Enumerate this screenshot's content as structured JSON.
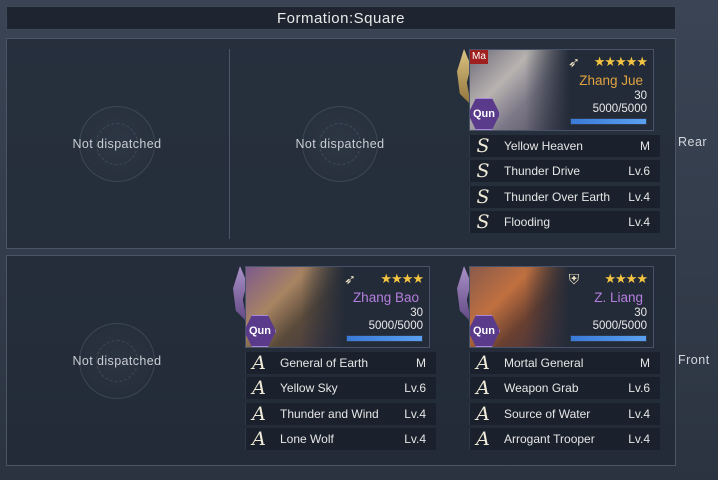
{
  "formation": {
    "title": "Formation:Square"
  },
  "rows": {
    "rear": {
      "label": "Rear"
    },
    "front": {
      "label": "Front"
    }
  },
  "empty_text": "Not dispatched",
  "generals": {
    "zhang_jue": {
      "tag": "Ma",
      "class_icon": "bow-icon",
      "stars": "★★★★★",
      "name": "Zhang Jue",
      "level": "30",
      "troops": "5000/5000",
      "troop_fill": 1.0,
      "faction": "Qun",
      "skills": [
        {
          "grade": "S",
          "name": "Yellow Heaven",
          "lv": "M"
        },
        {
          "grade": "S",
          "name": "Thunder Drive",
          "lv": "Lv.6"
        },
        {
          "grade": "S",
          "name": "Thunder Over Earth",
          "lv": "Lv.4"
        },
        {
          "grade": "S",
          "name": "Flooding",
          "lv": "Lv.4"
        }
      ]
    },
    "zhang_bao": {
      "class_icon": "bow-icon",
      "stars": "★★★★",
      "name": "Zhang Bao",
      "level": "30",
      "troops": "5000/5000",
      "troop_fill": 1.0,
      "faction": "Qun",
      "skills": [
        {
          "grade": "A",
          "name": "General of Earth",
          "lv": "M"
        },
        {
          "grade": "A",
          "name": "Yellow Sky",
          "lv": "Lv.6"
        },
        {
          "grade": "A",
          "name": "Thunder and Wind",
          "lv": "Lv.4"
        },
        {
          "grade": "A",
          "name": "Lone Wolf",
          "lv": "Lv.4"
        }
      ]
    },
    "z_liang": {
      "class_icon": "shield-icon",
      "stars": "★★★★",
      "name": "Z. Liang",
      "level": "30",
      "troops": "5000/5000",
      "troop_fill": 1.0,
      "faction": "Qun",
      "skills": [
        {
          "grade": "A",
          "name": "Mortal General",
          "lv": "M"
        },
        {
          "grade": "A",
          "name": "Weapon Grab",
          "lv": "Lv.6"
        },
        {
          "grade": "A",
          "name": "Source of Water",
          "lv": "Lv.4"
        },
        {
          "grade": "A",
          "name": "Arrogant Trooper",
          "lv": "Lv.4"
        }
      ]
    }
  },
  "colors": {
    "name_gold": "#e0a340",
    "name_purple": "#b57fe0",
    "star": "#f5c542",
    "troop_bar": "#3a7ad8"
  }
}
